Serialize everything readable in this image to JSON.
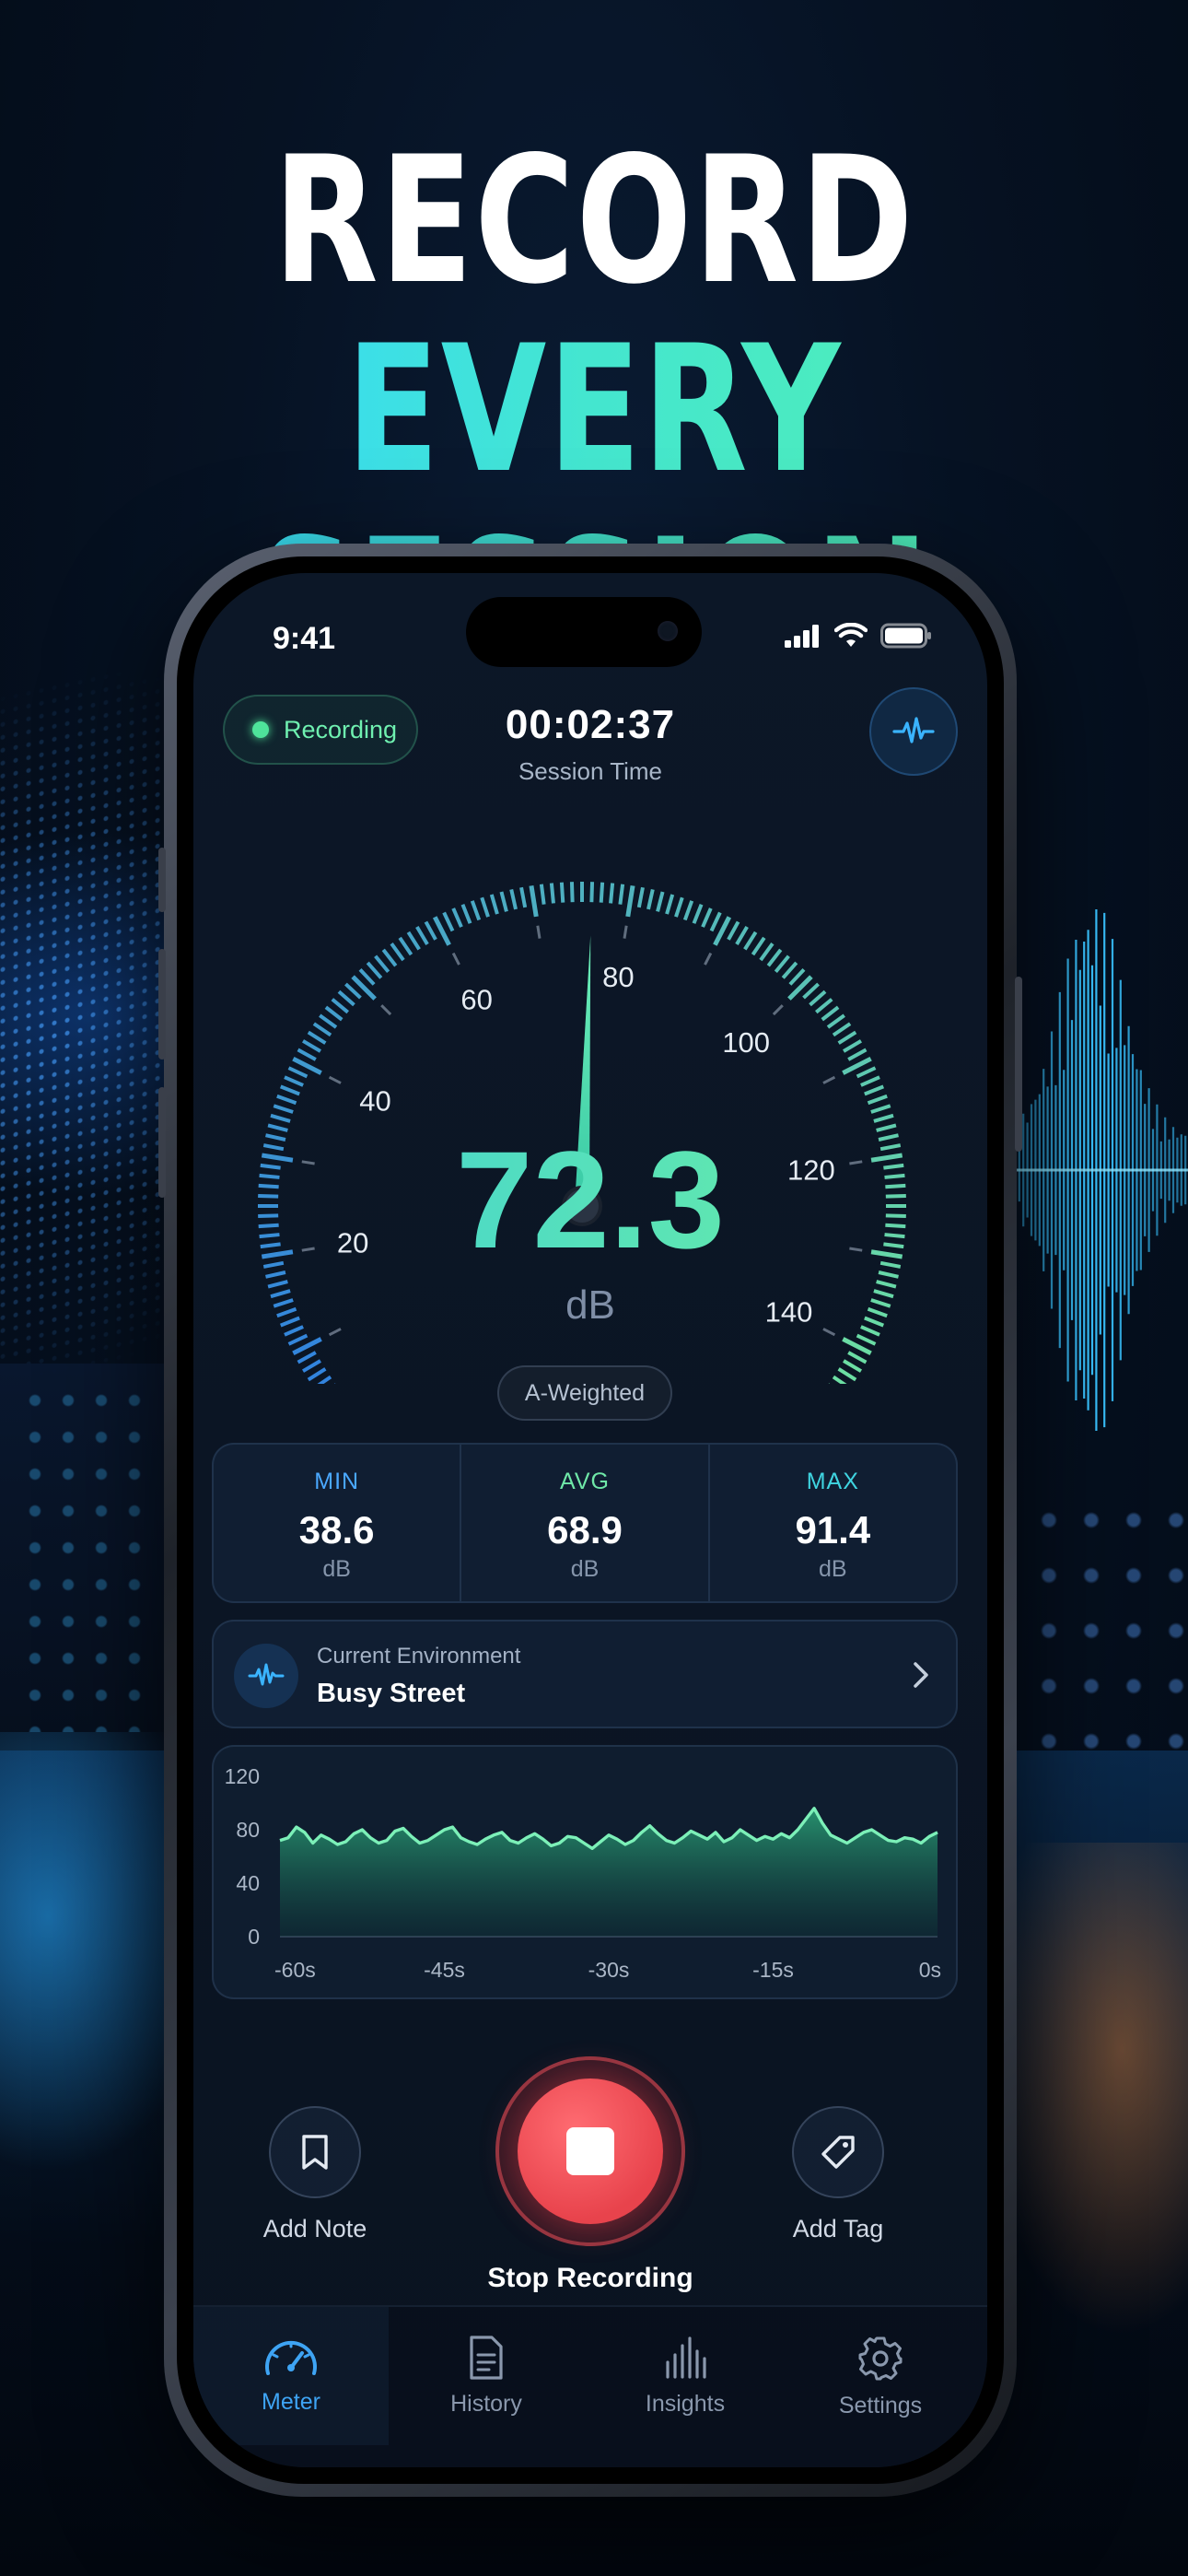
{
  "headline": {
    "line1": "RECORD",
    "line2": "EVERY SESSION"
  },
  "status_bar": {
    "time": "9:41"
  },
  "recording_status": {
    "label": "Recording",
    "color": "#4ee39a"
  },
  "session": {
    "time": "00:02:37",
    "label": "Session Time"
  },
  "gauge": {
    "min": 0,
    "max": 150,
    "tick_labels": [
      "20",
      "40",
      "60",
      "80",
      "100",
      "120",
      "140"
    ],
    "needle_value": 76,
    "reading": "72.3",
    "unit": "dB",
    "weighting": "A-Weighted",
    "gradient_start": "#2f7fe0",
    "gradient_end": "#6fe3a0"
  },
  "stats": [
    {
      "label": "MIN",
      "value": "38.6",
      "unit": "dB",
      "color": "#4aa8ff"
    },
    {
      "label": "AVG",
      "value": "68.9",
      "unit": "dB",
      "color": "#6fe8a8"
    },
    {
      "label": "MAX",
      "value": "91.4",
      "unit": "dB",
      "color": "#3fd4e0"
    }
  ],
  "environment": {
    "label": "Current Environment",
    "value": "Busy Street"
  },
  "history_chart": {
    "y_ticks": [
      "120",
      "80",
      "40",
      "0"
    ],
    "x_ticks": [
      "-60s",
      "-45s",
      "-30s",
      "-15s",
      "0s"
    ],
    "y_range": [
      0,
      120
    ],
    "x_range": [
      -60,
      0
    ],
    "values": [
      72,
      74,
      82,
      78,
      70,
      76,
      73,
      69,
      71,
      77,
      80,
      74,
      70,
      72,
      79,
      81,
      75,
      70,
      72,
      76,
      80,
      82,
      74,
      71,
      69,
      73,
      76,
      78,
      72,
      70,
      74,
      77,
      73,
      68,
      70,
      75,
      74,
      70,
      66,
      71,
      76,
      73,
      69,
      72,
      78,
      83,
      77,
      72,
      70,
      74,
      79,
      76,
      73,
      78,
      71,
      74,
      80,
      76,
      72,
      75,
      73,
      77,
      74,
      80,
      88,
      96,
      85,
      76,
      73,
      70,
      74,
      78,
      80,
      76,
      72,
      71,
      74,
      73,
      70,
      75,
      78
    ]
  },
  "controls": {
    "add_note": "Add Note",
    "add_tag": "Add Tag",
    "stop": "Stop Recording"
  },
  "tabs": [
    {
      "label": "Meter",
      "icon": "gauge-icon",
      "active": true
    },
    {
      "label": "History",
      "icon": "document-icon",
      "active": false
    },
    {
      "label": "Insights",
      "icon": "bars-icon",
      "active": false
    },
    {
      "label": "Settings",
      "icon": "gear-icon",
      "active": false
    }
  ]
}
